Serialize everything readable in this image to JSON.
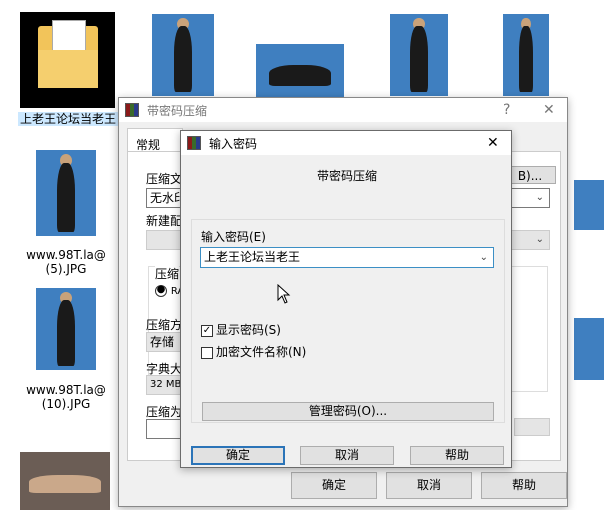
{
  "desktop": {
    "folder_label": "上老王论坛当老王",
    "file_5": "www.98T.la@\n(5).JPG",
    "file_5_a": "www.98T.la@",
    "file_5_b": "(5).JPG",
    "file_10_a": "www.98T.la@",
    "file_10_b": "(10).JPG"
  },
  "back_dialog": {
    "title": "带密码压缩",
    "help_icon": "?",
    "close_icon": "✕",
    "tab_general": "常规",
    "archive_name_label": "压缩文",
    "browse_button": "B)...",
    "archive_name_value": "无水印",
    "profile_label": "新建配",
    "format_group": "压缩",
    "format_rar": "RA",
    "method_label": "压缩方",
    "method_value": "存储",
    "dict_label": "字典大",
    "dict_value": "32 MB",
    "split_label": "压缩为",
    "ok": "确定",
    "cancel": "取消",
    "help": "帮助"
  },
  "password_dialog": {
    "title": "输入密码",
    "close_icon": "✕",
    "heading": "带密码压缩",
    "password_label": "输入密码(E)",
    "password_value": "上老王论坛当老王",
    "show_password": {
      "label": "显示密码(S)",
      "checked": true
    },
    "encrypt_names": {
      "label": "加密文件名称(N)",
      "checked": false
    },
    "manage_button": "管理密码(O)...",
    "ok": "确定",
    "cancel": "取消",
    "help": "帮助"
  }
}
